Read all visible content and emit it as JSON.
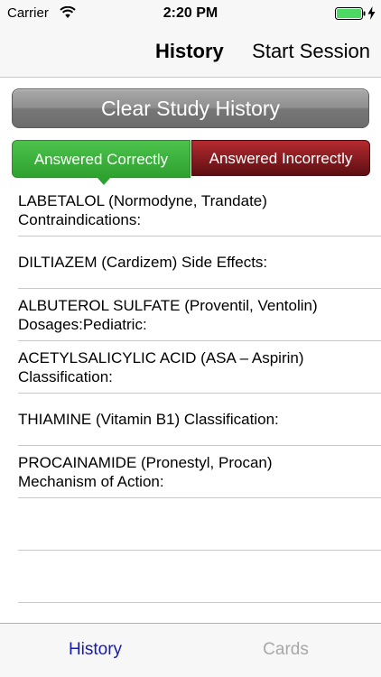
{
  "status_bar": {
    "carrier": "Carrier",
    "time": "2:20 PM",
    "wifi_icon": "wifi-icon",
    "battery_icon": "battery-icon",
    "battery_level": 1.0
  },
  "nav": {
    "title": "History",
    "action": "Start Session"
  },
  "clear_button": {
    "label": "Clear Study History"
  },
  "segments": {
    "correct": "Answered  Correctly",
    "incorrect": "Answered Incorrectly",
    "selected": "correct"
  },
  "history_items": [
    {
      "text": "LABETALOL (Normodyne, Trandate)\nContraindications:"
    },
    {
      "text": "DILTIAZEM (Cardizem) Side Effects:"
    },
    {
      "text": "ALBUTEROL SULFATE (Proventil, Ventolin)\nDosages:Pediatric:"
    },
    {
      "text": "ACETYLSALICYLIC ACID (ASA – Aspirin)\nClassification:"
    },
    {
      "text": "THIAMINE (Vitamin B1) Classification:"
    },
    {
      "text": "PROCAINAMIDE (Pronestyl, Procan)\nMechanism of Action:"
    },
    {
      "text": ""
    },
    {
      "text": ""
    }
  ],
  "tabs": {
    "history": "History",
    "cards": "Cards",
    "active": "history",
    "active_color": "#1a1aa8",
    "inactive_color": "#a8a8a8"
  }
}
